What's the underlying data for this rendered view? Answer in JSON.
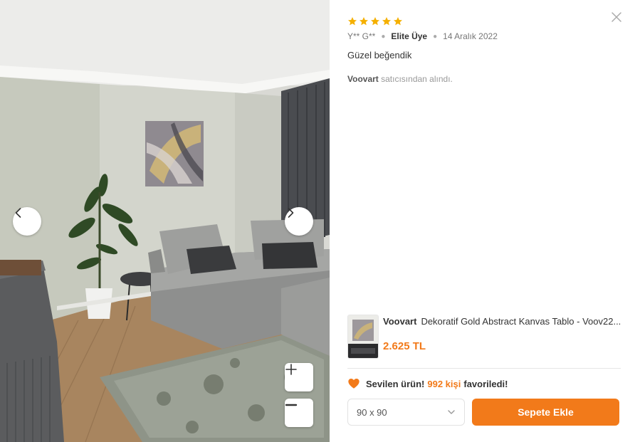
{
  "review": {
    "rating": 5,
    "user": "Y** G**",
    "tier": "Elite Üye",
    "date": "14 Aralık 2022",
    "comment": "Güzel beğendik",
    "seller_name": "Voovart",
    "seller_suffix": " satıcısından alındı."
  },
  "product": {
    "brand": "Voovart",
    "title": "Dekoratif Gold Abstract Kanvas Tablo - Voov22...",
    "price": "2.625 TL"
  },
  "favorites": {
    "prefix": "Sevilen ürün! ",
    "count": "992 kişi",
    "suffix": " favoriledi!"
  },
  "size_select": {
    "value": "90 x 90"
  },
  "cart_button": {
    "label": "Sepete Ekle"
  },
  "colors": {
    "accent": "#f27a1a",
    "star": "#f5b000"
  },
  "icons": {
    "prev": "chevron-left-icon",
    "next": "chevron-right-icon",
    "zoom_in": "plus-icon",
    "zoom_out": "minus-icon",
    "close": "close-icon",
    "heart": "heart-icon",
    "dropdown": "chevron-down-icon"
  }
}
